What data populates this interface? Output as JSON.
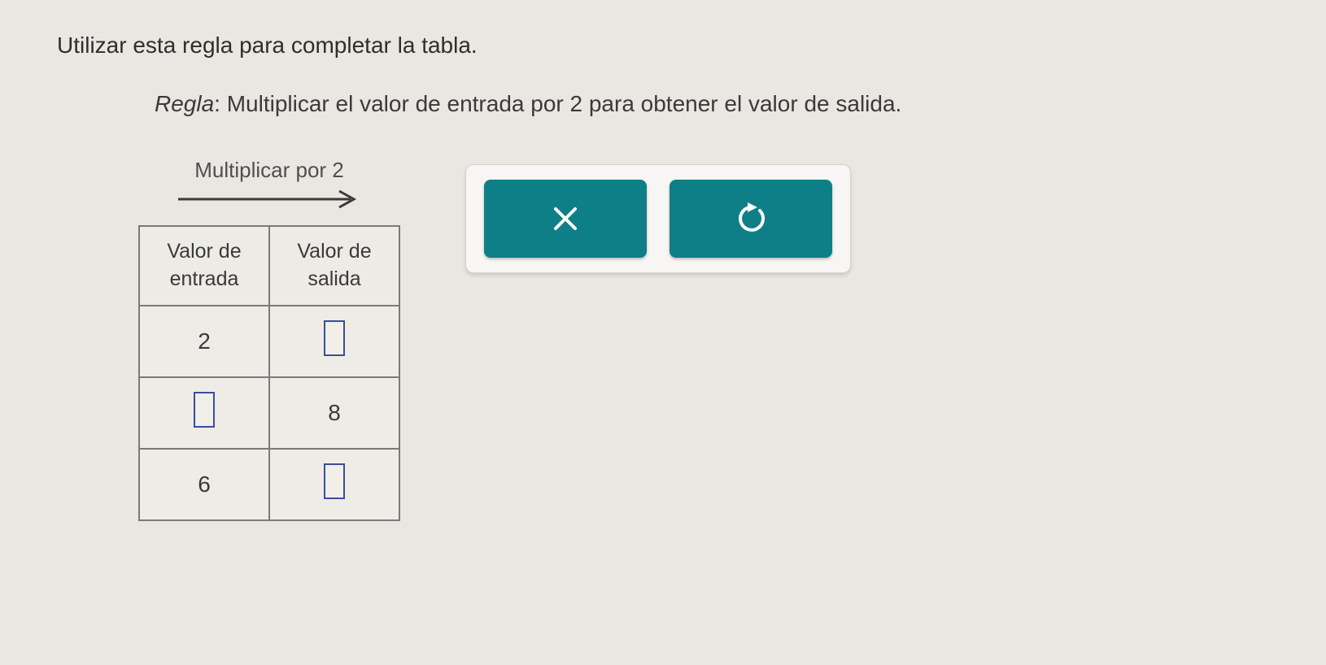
{
  "instruction": "Utilizar esta regla para completar la tabla.",
  "rule_label": "Regla",
  "rule_text": ": Multiplicar el valor de entrada por 2 para obtener el valor de salida.",
  "table": {
    "caption": "Multiplicar por 2",
    "header_in": "Valor de\nentrada",
    "header_out": "Valor de\nsalida",
    "rows": [
      {
        "in": "2",
        "out": ""
      },
      {
        "in": "",
        "out": "8"
      },
      {
        "in": "6",
        "out": ""
      }
    ]
  },
  "buttons": {
    "close": "close-icon",
    "reset": "reset-icon"
  }
}
